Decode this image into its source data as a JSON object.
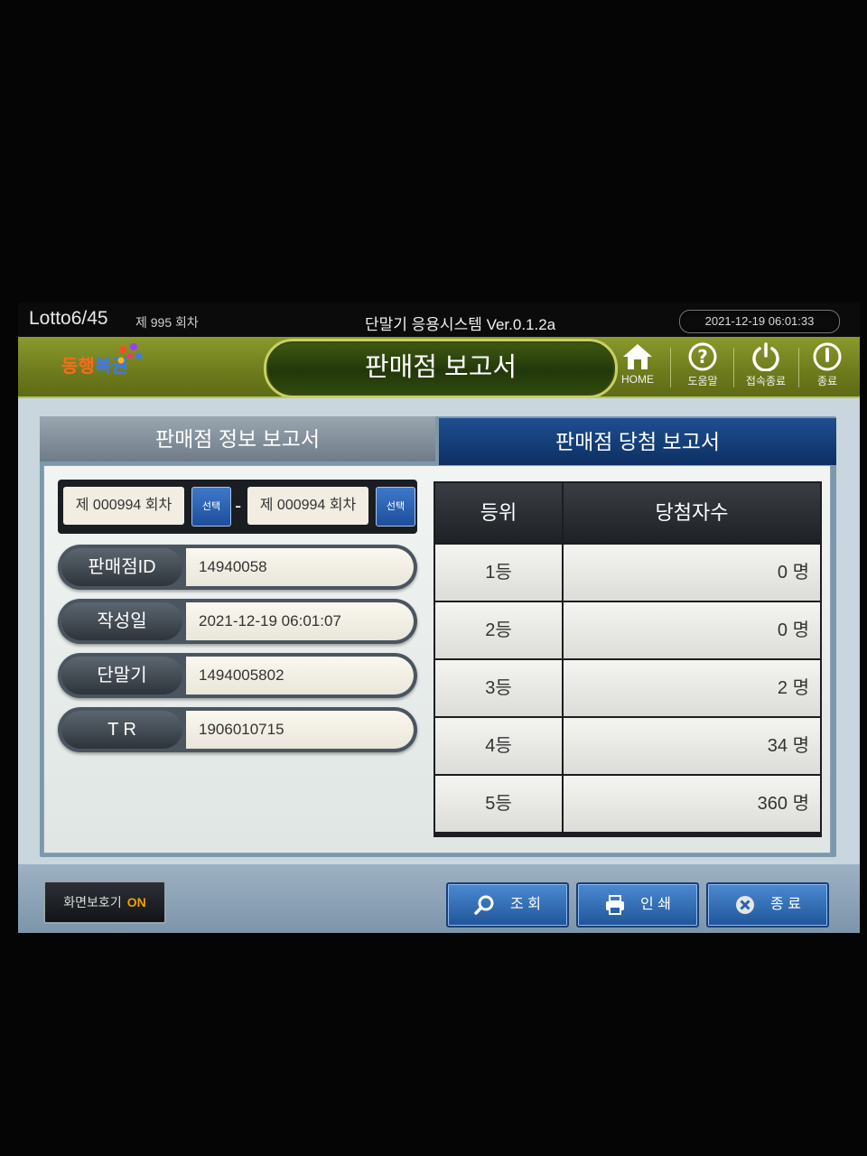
{
  "statusbar": {
    "lotto_name": "Lotto6/45",
    "round_info": "제 995 회차",
    "app_title": "단말기 응용시스템  Ver.0.1.2a",
    "datetime": "2021-12-19  06:01:33"
  },
  "header": {
    "logo_part1": "동행",
    "logo_part2": "복권",
    "title": "판매점 보고서",
    "buttons": [
      {
        "label": "HOME",
        "icon": "home-icon"
      },
      {
        "label": "도움말",
        "icon": "help-icon"
      },
      {
        "label": "접속종료",
        "icon": "power-icon"
      },
      {
        "label": "종료",
        "icon": "exit-icon"
      }
    ]
  },
  "tabs": {
    "info_report": "판매점 정보 보고서",
    "win_report": "판매점 당첨 보고서"
  },
  "round_select": {
    "from": "제 000994 회차",
    "to": "제 000994 회차",
    "select_label": "선택",
    "separator": "-"
  },
  "info": [
    {
      "label": "판매점ID",
      "value": "14940058"
    },
    {
      "label": "작성일",
      "value": "2021-12-19  06:01:07"
    },
    {
      "label": "단말기",
      "value": "1494005802"
    },
    {
      "label": "T  R",
      "value": "1906010715"
    }
  ],
  "results_table": {
    "headers": [
      "등위",
      "당첨자수"
    ],
    "rows": [
      {
        "rank": "1등",
        "count": "0  명"
      },
      {
        "rank": "2등",
        "count": "0  명"
      },
      {
        "rank": "3등",
        "count": "2  명"
      },
      {
        "rank": "4등",
        "count": "34  명"
      },
      {
        "rank": "5등",
        "count": "360  명"
      }
    ]
  },
  "bottom": {
    "screensaver_label": "화면보호기",
    "screensaver_state": "ON",
    "search_label": "조  회",
    "print_label": "인  쇄",
    "close_label": "종  료"
  },
  "colors": {
    "header_bg": "#7a8a24",
    "tab_active": "#123a74",
    "button_blue": "#2d67b3",
    "screensaver_on": "#f0a000"
  }
}
